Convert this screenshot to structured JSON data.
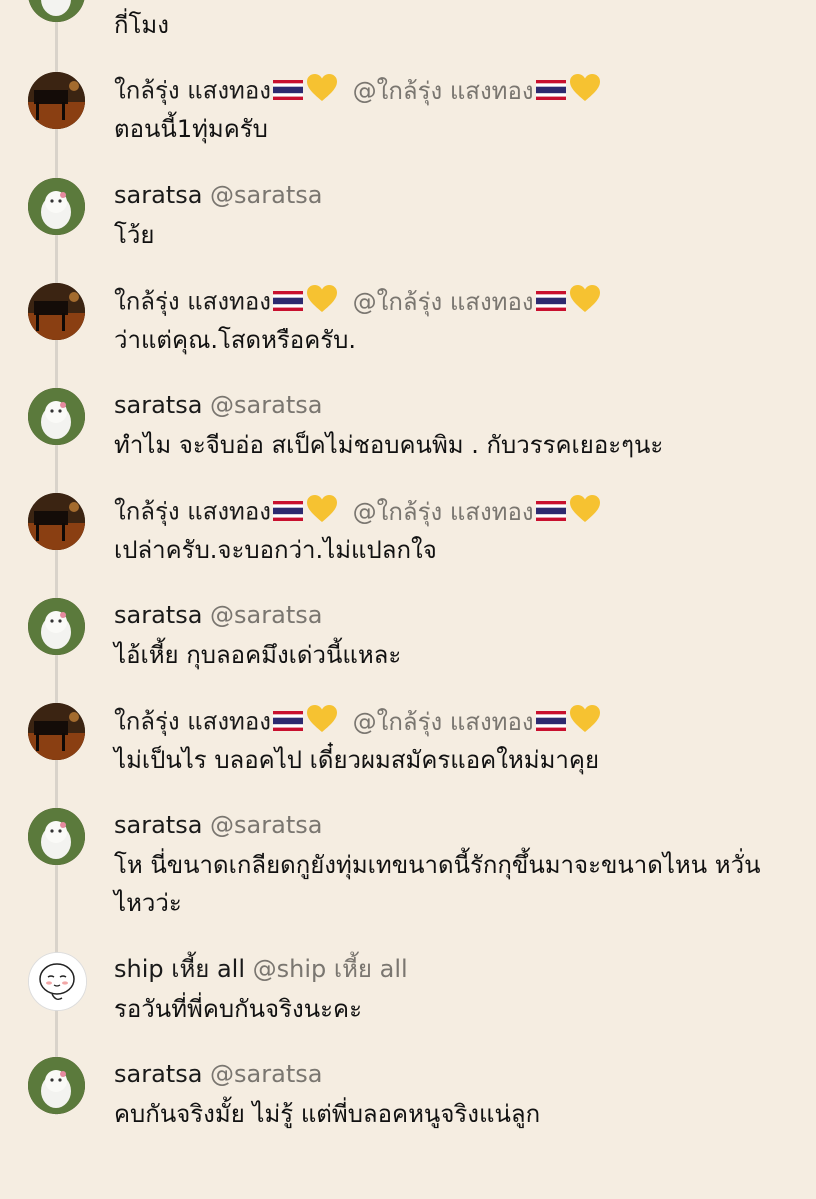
{
  "messages": [
    {
      "type": "cat",
      "name": "",
      "handle": "",
      "flag": false,
      "heart": false,
      "text": "กี่โมง"
    },
    {
      "type": "piano",
      "name": "ใกล้รุ่ง แสงทอง",
      "handle": "@ใกล้รุ่ง แสงทอง",
      "flag": true,
      "heart": true,
      "text": "ตอนนี้1ทุ่มครับ"
    },
    {
      "type": "cat",
      "name": "saratsa",
      "handle": "@saratsa",
      "flag": false,
      "heart": false,
      "text": "โว้ย"
    },
    {
      "type": "piano",
      "name": "ใกล้รุ่ง แสงทอง",
      "handle": "@ใกล้รุ่ง แสงทอง",
      "flag": true,
      "heart": true,
      "text": "ว่าแต่คุณ.โสดหรือครับ."
    },
    {
      "type": "cat",
      "name": "saratsa",
      "handle": "@saratsa",
      "flag": false,
      "heart": false,
      "text": "ทำไม จะจีบอ่อ สเป็คไม่ชอบคนพิม . กับวรรคเยอะๆนะ"
    },
    {
      "type": "piano",
      "name": "ใกล้รุ่ง แสงทอง",
      "handle": "@ใกล้รุ่ง แสงทอง",
      "flag": true,
      "heart": true,
      "text": "เปล่าครับ.จะบอกว่า.ไม่แปลกใจ"
    },
    {
      "type": "cat",
      "name": "saratsa",
      "handle": "@saratsa",
      "flag": false,
      "heart": false,
      "text": "ไอ้เหี้ย กุบลอคมึงเด่วนี้แหละ"
    },
    {
      "type": "piano",
      "name": "ใกล้รุ่ง แสงทอง",
      "handle": "@ใกล้รุ่ง แสงทอง",
      "flag": true,
      "heart": true,
      "text": "ไม่เป็นไร บลอคไป เดี๋ยวผมสมัครแอคใหม่มาคุย"
    },
    {
      "type": "cat",
      "name": "saratsa",
      "handle": "@saratsa",
      "flag": false,
      "heart": false,
      "text": "โห นี่ขนาดเกลียดกูยังทุ่มเทขนาดนี้รักกุขึ้นมาจะขนาดไหน หวั่นไหวว่ะ"
    },
    {
      "type": "face",
      "name": "ship เหี้ย all",
      "handle": "@ship เหี้ย all",
      "flag": false,
      "heart": false,
      "text": "รอวันที่พี่คบกันจริงนะคะ"
    },
    {
      "type": "cat",
      "name": "saratsa",
      "handle": "@saratsa",
      "flag": false,
      "heart": false,
      "text": "คบกันจริงมั้ย ไม่รู้ แต่พี่บลอคหนูจริงแน่ลูก"
    }
  ]
}
